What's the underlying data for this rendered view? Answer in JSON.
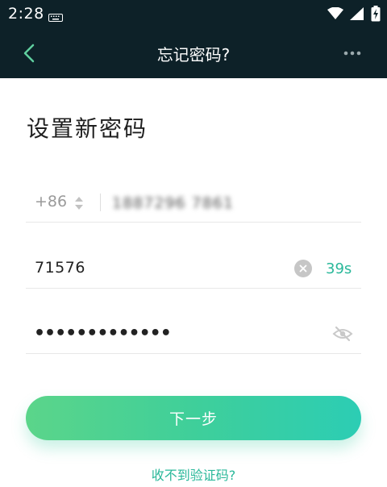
{
  "status_bar": {
    "time": "2:28",
    "icons": [
      "keyboard-icon",
      "wifi-icon",
      "signal-icon",
      "battery-charging-icon"
    ]
  },
  "app_bar": {
    "title": "忘记密码?",
    "back_icon": "chevron-left-icon",
    "more_icon": "more-horizontal-icon"
  },
  "page": {
    "heading": "设置新密码"
  },
  "form": {
    "phone": {
      "country_code": "+86",
      "number_masked": "1887296 7861"
    },
    "code": {
      "value": "71576",
      "countdown": "39s"
    },
    "password": {
      "value": "•••••••••••••"
    }
  },
  "actions": {
    "next_label": "下一步",
    "no_code_link": "收不到验证码?"
  },
  "colors": {
    "header_bg": "#0d2128",
    "accent": "#2ab89a",
    "button_gradient_start": "#5bd58a",
    "button_gradient_end": "#2ccdb4"
  }
}
